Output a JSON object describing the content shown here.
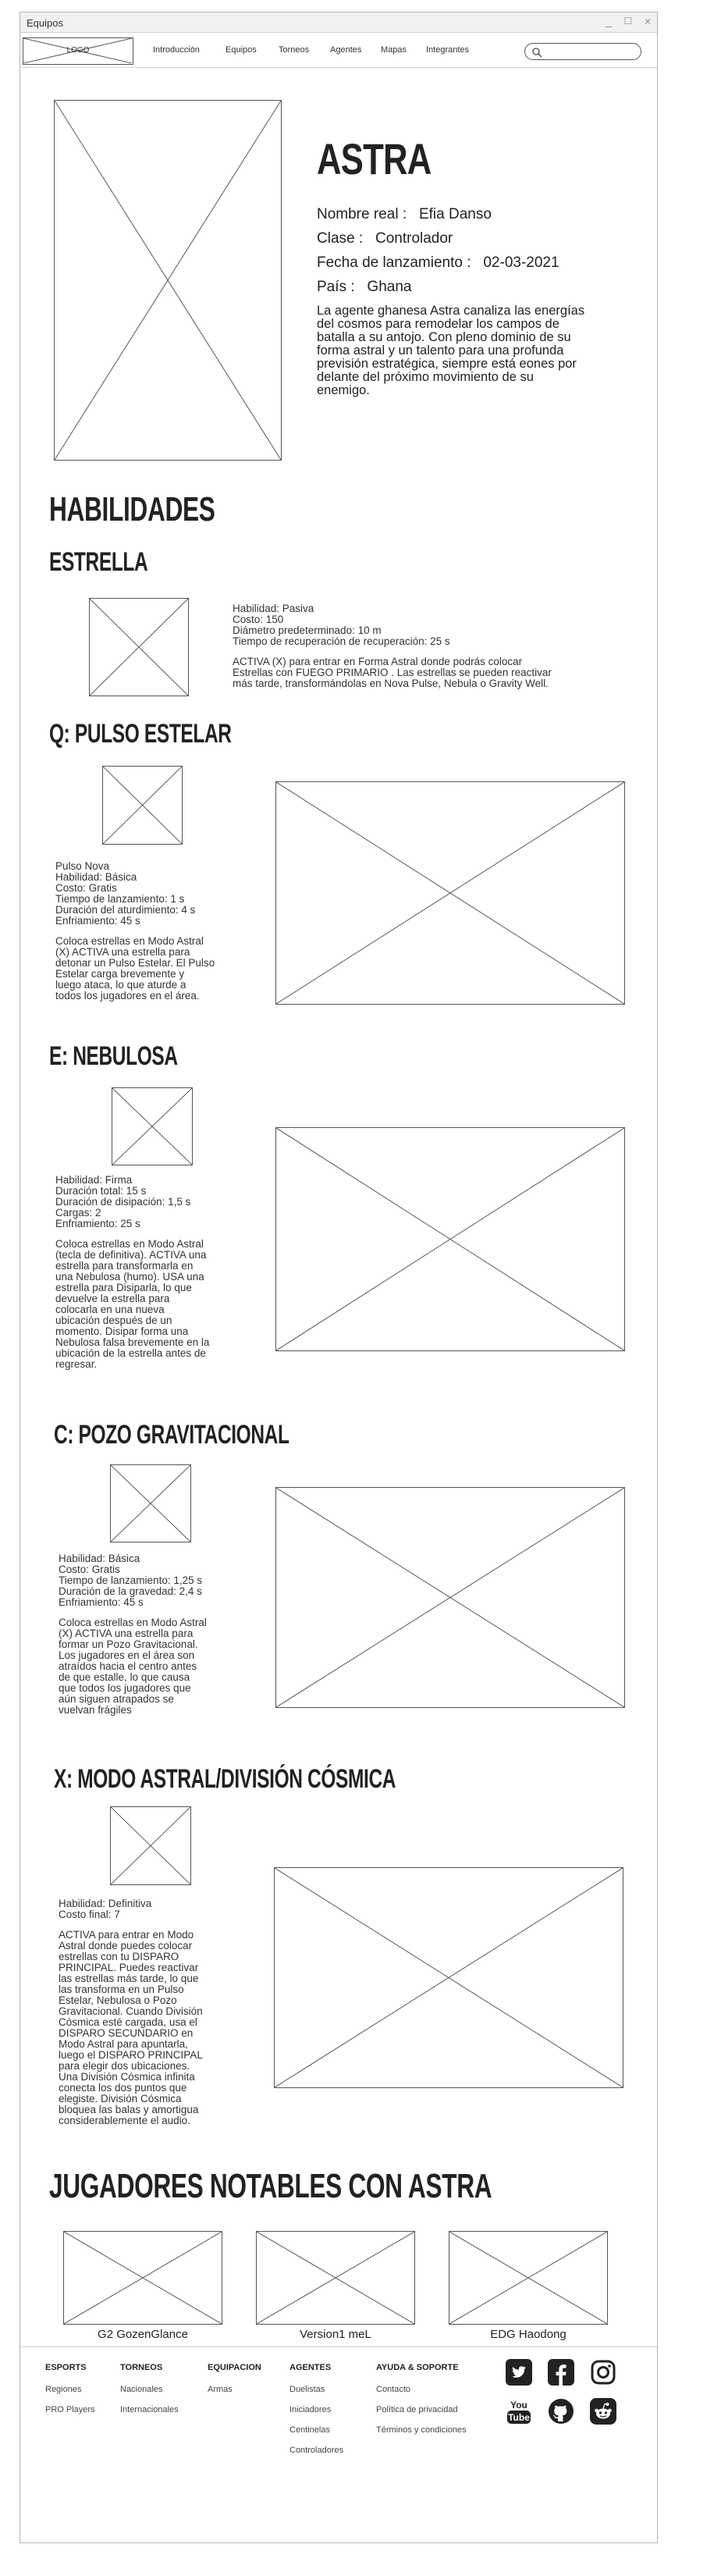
{
  "window": {
    "title": "Equipos",
    "controls": [
      "_",
      "☐",
      "×"
    ]
  },
  "nav": {
    "logo": "LOGO",
    "items": [
      "Introducción",
      "Equipos",
      "Torneos",
      "Agentes",
      "Mapas",
      "Integrantes"
    ],
    "search_icon": "search-icon"
  },
  "agent": {
    "name": "ASTRA",
    "real_name_label": "Nombre real :",
    "real_name": "Efia Danso",
    "class_label": "Clase :",
    "class": "Controlador",
    "release_label": "Fecha de lanzamiento :",
    "release": "02-03-2021",
    "country_label": "País :",
    "country": "Ghana",
    "bio": "La agente ghanesa Astra canaliza las energías del cosmos para remodelar los campos de batalla a su antojo. Con pleno dominio de su forma astral y un talento para una profunda previsión estratégica, siempre está eones por delante del próximo movimiento de su enemigo."
  },
  "abilities": {
    "heading": "HABILIDADES",
    "estrella": {
      "title": "ESTRELLA",
      "stats": [
        "Habilidad: Pasiva",
        "Costo: 150",
        "Diámetro predeterminado: 10 m",
        "Tiempo de recuperación de recuperación: 25 s"
      ],
      "desc": [
        "ACTIVA (X) para entrar en Forma Astral donde podrás colocar",
        "Estrellas con FUEGO PRIMARIO . Las estrellas se pueden reactivar",
        "más tarde, transformándolas en Nova Pulse, Nebula o Gravity Well."
      ]
    },
    "q": {
      "title": "Q: PULSO ESTELAR",
      "stats": [
        "Pulso Nova",
        "Habilidad: Básica",
        "Costo: Gratis",
        "Tiempo de lanzamiento: 1 s",
        "Duración del aturdimiento: 4 s",
        "Enfriamiento: 45 s"
      ],
      "desc": [
        "Coloca estrellas en Modo Astral",
        "(X) ACTIVA una estrella para",
        "detonar un Pulso Estelar. El Pulso",
        "Estelar carga brevemente y",
        "luego ataca, lo que aturde a",
        "todos los jugadores en el área."
      ]
    },
    "e": {
      "title": "E: NEBULOSA",
      "stats": [
        "Habilidad: Firma",
        "Duración total: 15 s",
        "Duración de disipación: 1,5 s",
        "Cargas: 2",
        "Enfriamiento: 25 s"
      ],
      "desc": [
        "Coloca estrellas en Modo Astral",
        "(tecla de definitiva). ACTIVA una",
        "estrella para transformarla en",
        "una Nebulosa (humo). USA una",
        "estrella para Disiparla, lo que",
        "devuelve la estrella para",
        "colocarla en una nueva",
        "ubicación después de un",
        "momento. Disipar forma una",
        "Nebulosa falsa brevemente en la",
        "ubicación de la estrella antes de",
        "regresar."
      ]
    },
    "c": {
      "title": "C: POZO GRAVITACIONAL",
      "stats": [
        "Habilidad: Básica",
        "Costo: Gratis",
        "Tiempo de lanzamiento: 1,25 s",
        "Duración de la gravedad: 2,4 s",
        "Enfriamiento: 45 s"
      ],
      "desc": [
        "Coloca estrellas en Modo Astral",
        "(X) ACTIVA una estrella para",
        "formar un Pozo Gravitacional.",
        "Los jugadores en el área son",
        "atraídos hacia el centro antes",
        "de que estalle, lo que causa",
        "que todos los jugadores que",
        "aún siguen atrapados se",
        "vuelvan frágiles"
      ]
    },
    "x": {
      "title": "X: MODO ASTRAL/DIVISIÓN CÓSMICA",
      "stats": [
        "Habilidad: Definitiva",
        "Costo final: 7"
      ],
      "desc": [
        "ACTIVA para entrar en Modo",
        "Astral donde puedes colocar",
        "estrellas con tu DISPARO",
        "PRINCIPAL. Puedes reactivar",
        "las estrellas más tarde, lo que",
        "las transforma en un Pulso",
        "Estelar, Nebulosa o Pozo",
        "Gravitacional. Cuando División",
        "Cósmica esté cargada, usa el",
        "DISPARO SECUNDARIO en",
        "Modo Astral para apuntarla,",
        "luego el DISPARO PRINCIPAL",
        "para elegir dos ubicaciones.",
        "Una División Cósmica infinita",
        "conecta los dos puntos que",
        "elegiste. División Cósmica",
        "bloquea las balas y amortigua",
        "considerablemente el audio."
      ]
    }
  },
  "players": {
    "heading": "JUGADORES NOTABLES CON ASTRA",
    "items": [
      "G2 GozenGlance",
      "Version1 meL",
      "EDG Haodong"
    ]
  },
  "footer": {
    "esports": {
      "title": "ESPORTS",
      "links": [
        "Regiones",
        "PRO Players"
      ]
    },
    "torneos": {
      "title": "TORNEOS",
      "links": [
        "Nacionales",
        "Internacionales"
      ]
    },
    "equipacion": {
      "title": "EQUIPACION",
      "links": [
        "Armas"
      ]
    },
    "agentes": {
      "title": "AGENTES",
      "links": [
        "Duelistas",
        "Iniciadores",
        "Centinelas",
        "Controladores"
      ]
    },
    "ayuda": {
      "title": "AYUDA & SOPORTE",
      "links": [
        "Contacto",
        "Política de privacidad",
        "Términos y condiciones"
      ]
    },
    "social": [
      "twitter-icon",
      "facebook-icon",
      "instagram-icon",
      "youtube-icon",
      "github-icon",
      "reddit-icon"
    ]
  }
}
